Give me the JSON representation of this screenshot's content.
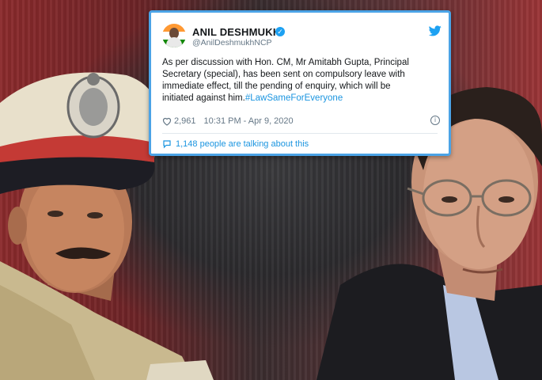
{
  "tweet": {
    "name": "ANIL DESHMUKH",
    "handle": "@AnilDeshmukhNCP",
    "text_lines": [
      "As per discussion with Hon. CM, Mr Amitabh Gupta, Principal",
      "Secretary (special), has been sent on compulsory leave with",
      "immediate effect, till the pending of enquiry, which will be",
      "initiated against him."
    ],
    "hashtag": "#LawSameForEveryone",
    "likes": "2,961",
    "timestamp": "10:31 PM - Apr 9, 2020",
    "talking": "1,148 people are talking about this"
  },
  "icons": {
    "verified": "verified-badge-icon",
    "bird": "twitter-bird-icon",
    "heart": "heart-icon",
    "info": "info-icon",
    "comment": "comment-bubble-icon"
  },
  "colors": {
    "tweet_border": "#4ba3e6",
    "link": "#1b95e0",
    "background_red": "#8b2a2c"
  }
}
